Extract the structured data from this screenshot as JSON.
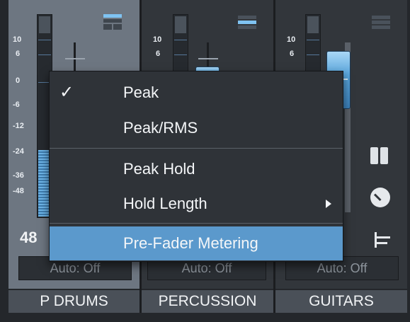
{
  "mixer": {
    "scale_labels": [
      "10",
      "6",
      "0",
      "-6",
      "-12",
      "-24",
      "-36",
      "-48"
    ],
    "channels": [
      {
        "name": "P DRUMS",
        "automation": "Auto: Off",
        "level_readout": "48",
        "meter_level": 0.32,
        "meter_mode_icon": "meter-mode-icon-active"
      },
      {
        "name": "PERCUSSION",
        "automation": "Auto: Off",
        "meter_level": 0.0,
        "meter_mode_icon": "meter-mode-icon-active"
      },
      {
        "name": "GUITARS",
        "automation": "Auto: Off",
        "meter_level": 0.0,
        "meter_mode_icon": "meter-mode-icon-inactive"
      }
    ],
    "side_icons": [
      "panel-toggle-icon",
      "pan-knob-icon",
      "routing-icon"
    ],
    "accent_color": "#5b99cc"
  },
  "context_menu": {
    "items": [
      {
        "label": "Peak",
        "checked": true
      },
      {
        "label": "Peak/RMS",
        "checked": false
      },
      {
        "label": "Peak Hold",
        "checked": false
      },
      {
        "label": "Hold Length",
        "checked": false,
        "has_submenu": true
      },
      {
        "label": "Pre-Fader Metering",
        "checked": false,
        "highlighted": true
      }
    ],
    "check_glyph": "✓"
  }
}
